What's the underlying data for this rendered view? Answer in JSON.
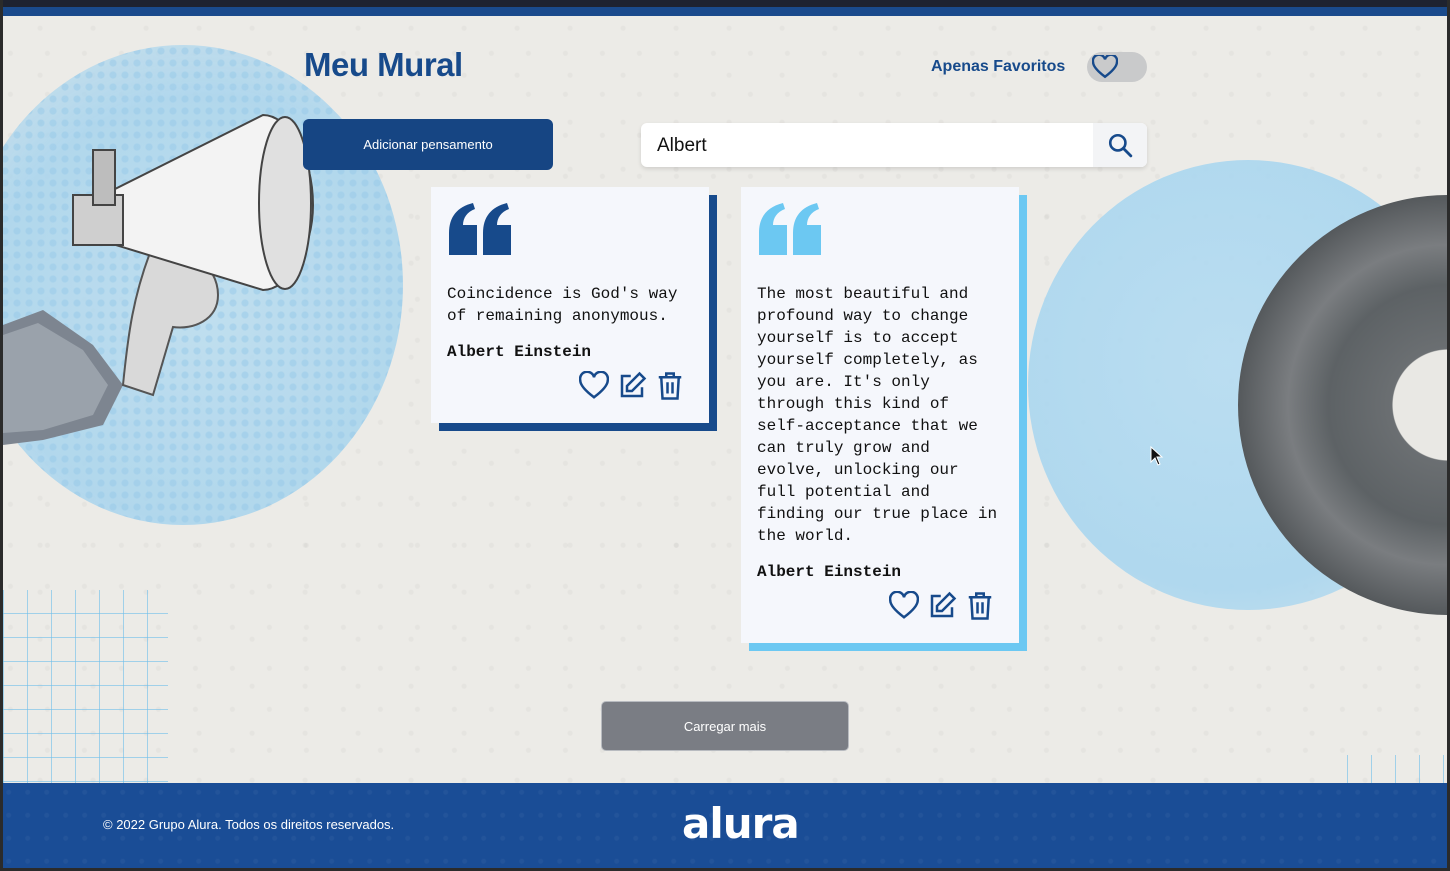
{
  "page": {
    "title": "Meu Mural",
    "favorites_label": "Apenas Favoritos",
    "favorites_enabled": false
  },
  "toolbar": {
    "add_button_label": "Adicionar pensamento",
    "search_value": "Albert"
  },
  "cards": [
    {
      "quote": "Coincidence is God's way\nof remaining anonymous.",
      "author": "Albert Einstein",
      "accent_color": "#174a8b"
    },
    {
      "quote": "The most beautiful and\nprofound way to change\nyourself is to accept\nyourself completely, as\nyou are. It's only\nthrough this kind of\nself-acceptance that we\ncan truly grow and\nevolve, unlocking our\nfull potential and\nfinding our true place in\nthe world.",
      "author": "Albert Einstein",
      "accent_color": "#6cc8f2"
    }
  ],
  "load_more_label": "Carregar mais",
  "footer": {
    "copyright": "© 2022 Grupo Alura. Todos os direitos reservados.",
    "logo_text": "alura"
  },
  "colors": {
    "primary": "#174a8b",
    "accent_light": "#6cc8f2",
    "footer_bg": "#1a4d96"
  }
}
